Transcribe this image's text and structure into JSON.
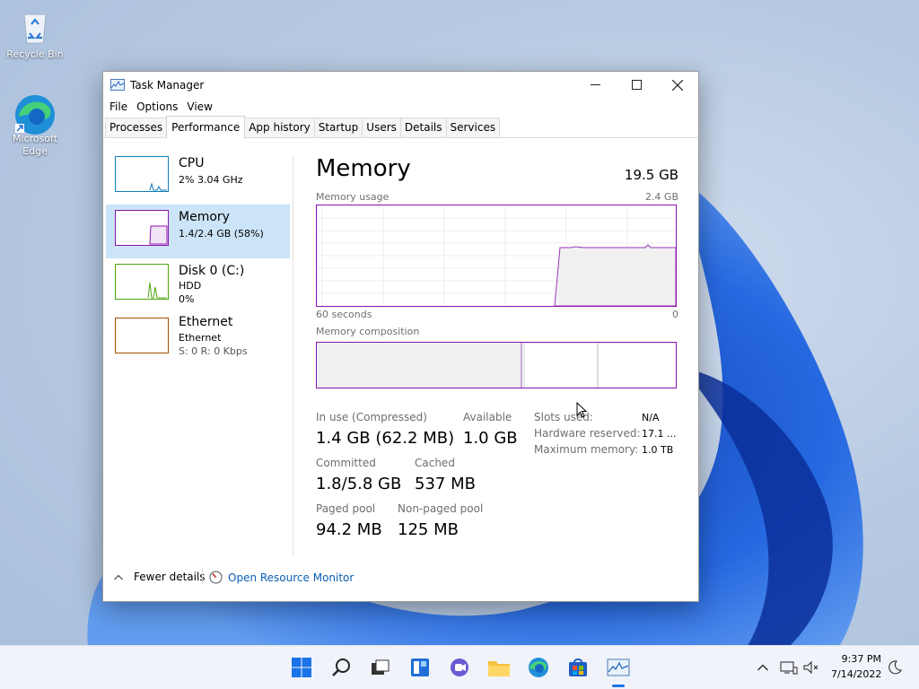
{
  "desktop": {
    "icons": [
      {
        "label": "Recycle Bin"
      },
      {
        "label": "Microsoft Edge"
      }
    ]
  },
  "window": {
    "title": "Task Manager",
    "menu": [
      "File",
      "Options",
      "View"
    ],
    "tabs": [
      "Processes",
      "Performance",
      "App history",
      "Startup",
      "Users",
      "Details",
      "Services"
    ],
    "active_tab": "Performance"
  },
  "sidebar": {
    "items": [
      {
        "title": "CPU",
        "line1": "2% 3.04 GHz",
        "line2": "",
        "color": "#117dbb"
      },
      {
        "title": "Memory",
        "line1": "1.4/2.4 GB (58%)",
        "line2": "",
        "color": "#8b12ae"
      },
      {
        "title": "Disk 0 (C:)",
        "line1": "HDD",
        "line2": "0%",
        "color": "#4da60c"
      },
      {
        "title": "Ethernet",
        "line1": "Ethernet",
        "line2": "S: 0 R: 0 Kbps",
        "color": "#a74f01"
      }
    ]
  },
  "memory": {
    "title": "Memory",
    "total": "19.5 GB",
    "usage_label": "Memory usage",
    "usage_max": "2.4 GB",
    "axis_left": "60 seconds",
    "axis_right": "0",
    "composition_label": "Memory composition",
    "stats": {
      "in_use_label": "In use (Compressed)",
      "in_use": "1.4 GB (62.2 MB)",
      "available_label": "Available",
      "available": "1.0 GB",
      "committed_label": "Committed",
      "committed": "1.8/5.8 GB",
      "cached_label": "Cached",
      "cached": "537 MB",
      "paged_label": "Paged pool",
      "paged": "94.2 MB",
      "nonpaged_label": "Non-paged pool",
      "nonpaged": "125 MB",
      "slots_label": "Slots used:",
      "slots": "N/A",
      "hw_label": "Hardware reserved:",
      "hw": "17.1 ...",
      "max_label": "Maximum memory:",
      "max": "1.0 TB"
    }
  },
  "footer": {
    "fewer": "Fewer details",
    "open_rm": "Open Resource Monitor"
  },
  "taskbar": {
    "time": "9:37 PM",
    "date": "7/14/2022"
  }
}
